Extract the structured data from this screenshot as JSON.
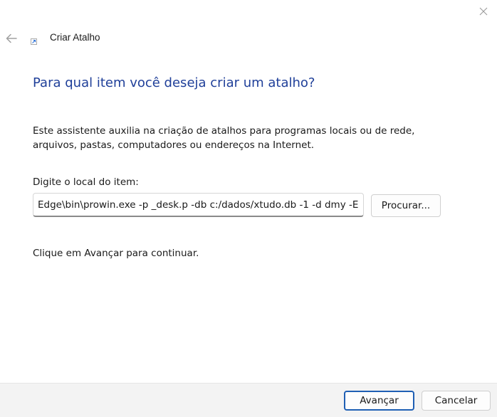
{
  "window": {
    "title": "Criar Atalho",
    "icon": "shortcut-icon",
    "close_icon": "close-icon",
    "back_icon": "back-arrow-icon"
  },
  "main": {
    "heading": "Para qual item você deseja criar um atalho?",
    "description": "Este assistente auxilia na criação de atalhos para programas locais ou de rede, arquivos, pastas, computadores ou endereços na Internet.",
    "location_label": "Digite o local do item:",
    "location_value": "Edge\\bin\\prowin.exe -p _desk.p -db c:/dados/xtudo.db -1 -d dmy -E",
    "browse_label": "Procurar...",
    "continue_hint": "Clique em Avançar para continuar."
  },
  "footer": {
    "next_label": "Avançar",
    "cancel_label": "Cancelar"
  },
  "colors": {
    "heading": "#1f3f99",
    "accent": "#1f5fb4",
    "footer_bg": "#f3f3f3"
  }
}
